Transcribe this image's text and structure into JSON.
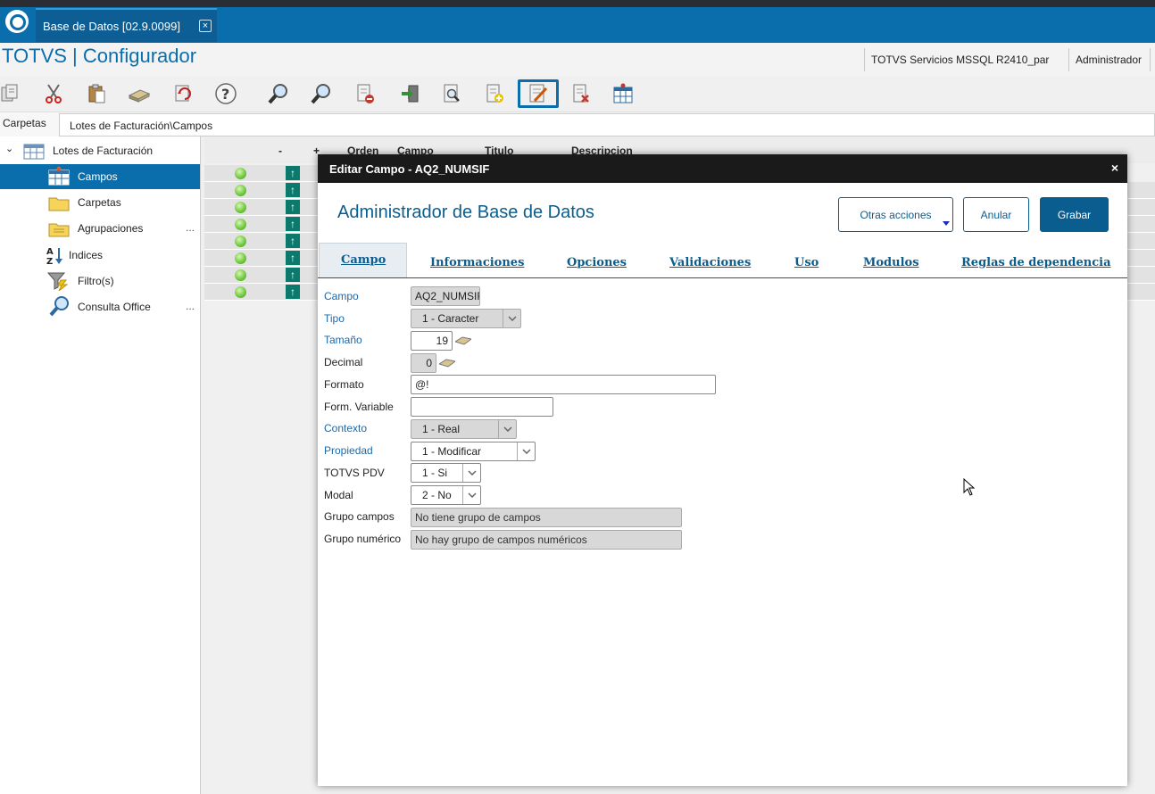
{
  "window": {
    "tab_title": "Base de Datos [02.9.0099]",
    "tab_close": "⊠"
  },
  "header": {
    "app_title": "TOTVS | Configurador",
    "environment": "TOTVS Servicios MSSQL R2410_par",
    "user": "Administrador"
  },
  "toolbar": {
    "icons": [
      "copy-icon",
      "cut-icon",
      "paste-icon",
      "database-icon",
      "refresh-icon",
      "help-icon",
      "search-icon",
      "search-next-icon",
      "delete-record-icon",
      "import-icon",
      "preview-icon",
      "add-record-icon",
      "edit-icon",
      "remove-icon",
      "table-icon"
    ],
    "selected": "edit-icon"
  },
  "breadcrumb": {
    "label": "Carpetas",
    "path": "Lotes de Facturación\\Campos"
  },
  "sidebar": {
    "root": "Lotes de Facturación",
    "items": [
      {
        "label": "Campos",
        "icon": "table-icon",
        "selected": true
      },
      {
        "label": "Carpetas",
        "icon": "folder-icon"
      },
      {
        "label": "Agrupaciones",
        "icon": "folder-group-icon",
        "dots": "..."
      },
      {
        "label": "Indices",
        "icon": "sort-az-icon"
      },
      {
        "label": "Filtro(s)",
        "icon": "filter-icon"
      },
      {
        "label": "Consulta Office",
        "icon": "magnifier-icon",
        "dots": "..."
      }
    ]
  },
  "grid": {
    "columns": [
      "-",
      "+",
      "Orden",
      "Campo",
      "Titulo",
      "Descripcion"
    ],
    "row_count": 8
  },
  "dialog": {
    "title": "Editar Campo - AQ2_NUMSIF",
    "close": "×",
    "heading": "Administrador de Base de Datos",
    "buttons": {
      "other": "Otras acciones",
      "cancel": "Anular",
      "save": "Grabar"
    },
    "tabs": [
      "Campo",
      "Informaciones",
      "Opciones",
      "Validaciones",
      "Uso",
      "Modulos",
      "Reglas de dependencia"
    ],
    "active_tab": "Campo",
    "fields": {
      "campo": {
        "label": "Campo",
        "value": "AQ2_NUMSIF"
      },
      "tipo": {
        "label": "Tipo",
        "value": "1 - Caracter"
      },
      "tamano": {
        "label": "Tamaño",
        "value": "19"
      },
      "decimal": {
        "label": "Decimal",
        "value": "0"
      },
      "formato": {
        "label": "Formato",
        "value": "@!"
      },
      "form_variable": {
        "label": "Form. Variable",
        "value": ""
      },
      "contexto": {
        "label": "Contexto",
        "value": "1 - Real"
      },
      "propiedad": {
        "label": "Propiedad",
        "value": "1 - Modificar"
      },
      "totvs_pdv": {
        "label": "TOTVS PDV",
        "value": "1 - Si"
      },
      "modal": {
        "label": "Modal",
        "value": "2 - No"
      },
      "grupo_campos": {
        "label": "Grupo campos",
        "value": "No tiene grupo de campos"
      },
      "grupo_numerico": {
        "label": "Grupo numérico",
        "value": "No hay grupo de campos numéricos"
      }
    }
  },
  "colors": {
    "brand": "#0a6ead",
    "dialog_title_bg": "#1a1a1a",
    "status_green": "#6cc63a"
  }
}
